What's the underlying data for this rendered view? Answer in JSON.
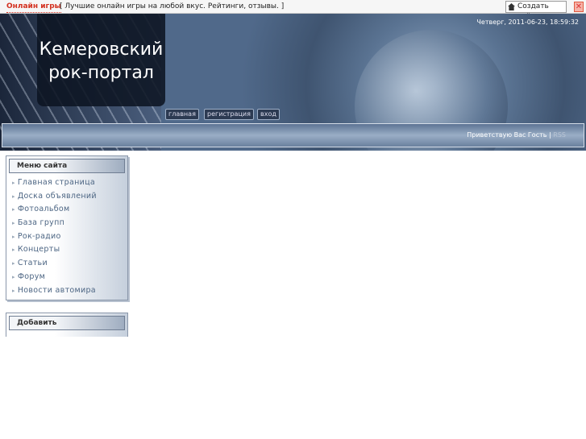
{
  "topbar": {
    "brand": "Онлайн игры",
    "promo": "[ Лучшие онлайн игры на любой вкус. Рейтинги, отзывы. ]",
    "create_site": "Создать сайт",
    "close": "✕"
  },
  "header": {
    "logo_line1": "Кемеровский",
    "logo_line2": "рок-портал",
    "date": "Четверг, 2011-06-23, 18:59:32",
    "nav": [
      "главная",
      "регистрация",
      "вход"
    ],
    "welcome": "Приветствую Вас Гость",
    "separator": "|",
    "rss": "RSS"
  },
  "menu": {
    "title": "Меню сайта",
    "items": [
      "Главная страница",
      "Доска объявлений",
      "Фотоальбом",
      "База групп",
      "Рок-радио",
      "Концерты",
      "Статьи",
      "Форум",
      "Новости автомира"
    ]
  },
  "add_block": {
    "title": "Добавить"
  }
}
